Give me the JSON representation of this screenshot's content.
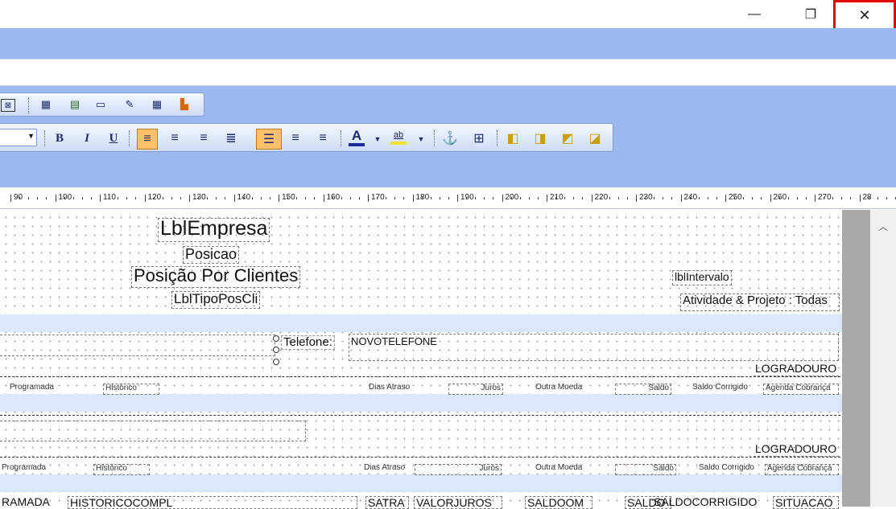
{
  "window": {
    "minimize_icon": "minimize-icon",
    "restore_icon": "restore-icon",
    "close_icon": "close-icon",
    "minimize_glyph": "—",
    "restore_glyph": "❐",
    "close_glyph": "✕"
  },
  "toolbar": {
    "bold": "B",
    "italic": "I",
    "underline": "U",
    "font_color": "A",
    "highlight": "ab"
  },
  "ruler": {
    "labels": [
      "90",
      "100",
      "110",
      "120",
      "130",
      "140",
      "150",
      "160",
      "170",
      "180",
      "190",
      "200",
      "210",
      "220",
      "230",
      "240",
      "250",
      "260",
      "270",
      "28"
    ]
  },
  "report": {
    "company": "LblEmpresa",
    "position": "Posicao",
    "title": "Posição Por Clientes",
    "pos_type": "LblTipoPosCli",
    "interval": "lblIntervalo",
    "activity": "Atividade & Projeto : Todas",
    "phone_label": "Telefone:",
    "phone_value": "NOVOTELEFONE",
    "address1": "LOGRADOURO",
    "address2": "LOGRADOURO",
    "row1": {
      "programada": "Programada",
      "historico": "Histórico",
      "dias_atraso": "Dias Atraso",
      "juros": "Juros",
      "outra_moeda": "Outra Moeda",
      "saldo": "Saldo",
      "saldo_corrigido": "Saldo Corrigido",
      "agenda_cobranca": "Agenda Cobrança"
    },
    "row2": {
      "programada": "Programada",
      "historico": "Histórico",
      "dias_atraso": "Dias Atraso",
      "juros": "Juros",
      "outra_moeda": "Outra Moeda",
      "saldo": "Saldo",
      "saldo_corrigido": "Saldo Corrigido",
      "agenda_cobranca": "Agenda Cobrança"
    },
    "detail": {
      "programada": "RAMADA",
      "historico": "HISTORICOCOMPL",
      "satra": "SATRA",
      "valorjuros": "VALORJUROS",
      "saldoom": "SALDOOM",
      "saldo": "SALDO",
      "saldocorrigido": "SALDOCORRIGIDO",
      "situacao": "SITUACAO"
    }
  }
}
